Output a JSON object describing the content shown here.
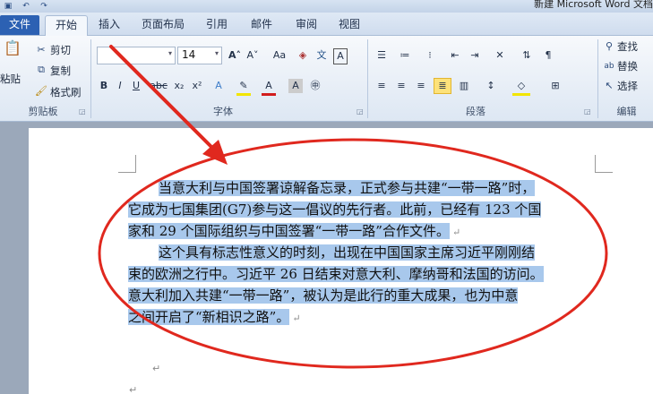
{
  "window": {
    "title": "新建 Microsoft Word 文档"
  },
  "tabs": [
    "文件",
    "开始",
    "插入",
    "页面布局",
    "引用",
    "邮件",
    "审阅",
    "视图"
  ],
  "ribbon": {
    "clipboard": {
      "paste": "粘贴",
      "cut": "剪切",
      "copy": "复制",
      "format_painter": "格式刷",
      "label": "剪贴板"
    },
    "font": {
      "font_name": "",
      "font_size": "14",
      "label": "字体"
    },
    "paragraph": {
      "label": "段落"
    },
    "editing": {
      "find": "查找",
      "replace": "替换",
      "select": "选择",
      "label": "编辑"
    }
  },
  "document": {
    "lines": [
      "当意大利与中国签署谅解备忘录，正式参与共建“一带一路”时，",
      "它成为七国集团(G7)参与这一倡议的先行者。此前，已经有 123 个国",
      "家和 29 个国际组织与中国签署“一带一路”合作文件。",
      "这个具有标志性意义的时刻，出现在中国国家主席习近平刚刚结",
      "束的欧洲之行中。习近平 26 日结束对意大利、摩纳哥和法国的访问。",
      "意大利加入共建“一带一路”，被认为是此行的重大成果，也为中意",
      "之间开启了“新相识之路”。"
    ],
    "paragraph_mark": "↵"
  },
  "colors": {
    "selection": "#a8c8ec",
    "annotation": "#e0281e",
    "file_tab": "#2c61b3"
  }
}
